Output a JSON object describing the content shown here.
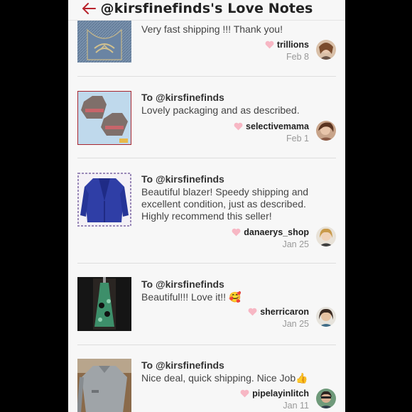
{
  "header": {
    "title": "@kirsfinefinds's Love Notes",
    "back_icon": "back-arrow-icon"
  },
  "colors": {
    "accent": "#b8232c",
    "heart": "#f7b7c4",
    "background": "#f7f7f7"
  },
  "notes": [
    {
      "to": "",
      "message": "Very fast shipping !!! Thank you!",
      "username": "trillions",
      "date": "Feb 8",
      "thumb_icon": "jeans-pocket-photo"
    },
    {
      "to": "To @kirsfinefinds",
      "message": "Lovely packaging and as described.",
      "username": "selectivemama",
      "date": "Feb 1",
      "thumb_icon": "sweater-photo"
    },
    {
      "to": "To @kirsfinefinds",
      "message": "Beautiful blazer! Speedy shipping and excellent condition, just as described. Highly recommend this seller!",
      "username": "danaerys_shop",
      "date": "Jan 25",
      "thumb_icon": "blue-blazer-photo"
    },
    {
      "to": "To @kirsfinefinds",
      "message": "Beautiful!!! Love it!! 🥰",
      "username": "sherricaron",
      "date": "Jan 25",
      "thumb_icon": "green-dress-photo"
    },
    {
      "to": "To @kirsfinefinds",
      "message": "Nice deal, quick shipping. Nice Job👍",
      "username": "pipelayinlitch",
      "date": "Jan 11",
      "thumb_icon": "gray-sweater-photo"
    }
  ]
}
